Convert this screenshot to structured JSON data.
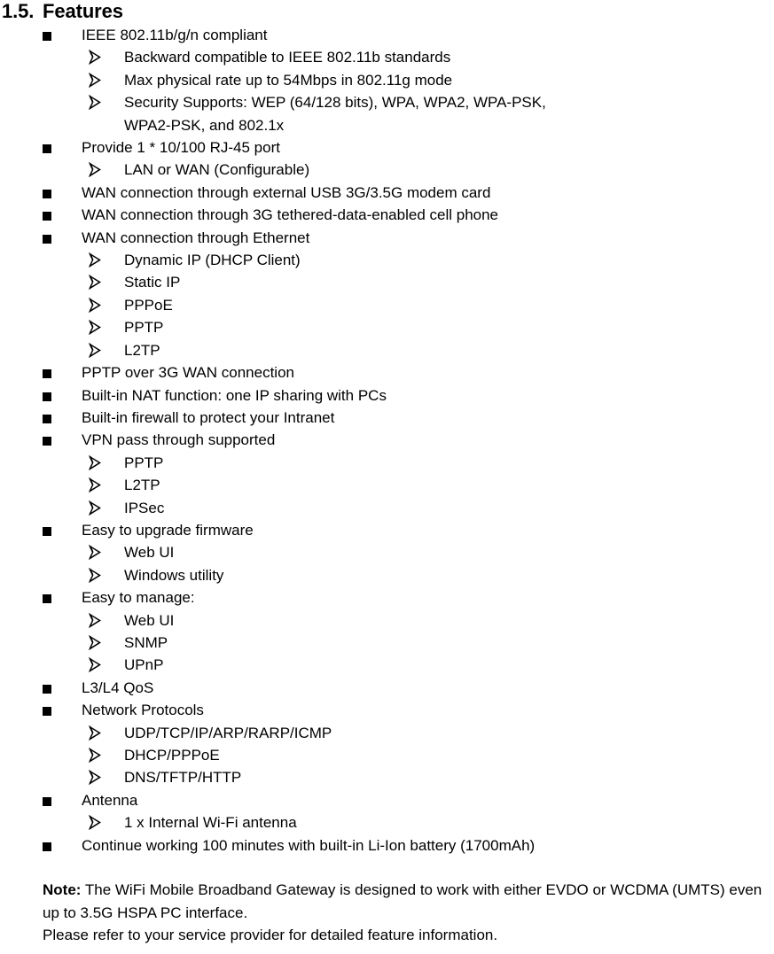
{
  "document": {
    "heading": {
      "number": "1.5.",
      "title": "Features"
    },
    "features": [
      {
        "level": 1,
        "text": "IEEE 802.11b/g/n compliant"
      },
      {
        "level": 2,
        "text": "Backward compatible to IEEE 802.11b standards"
      },
      {
        "level": 2,
        "text": "Max physical rate up to 54Mbps in 802.11g mode"
      },
      {
        "level": 2,
        "text": "Security Supports: WEP (64/128 bits), WPA, WPA2, WPA-PSK,",
        "text_continued": "WPA2-PSK, and 802.1x"
      },
      {
        "level": 1,
        "text": "Provide 1 * 10/100 RJ-45 port"
      },
      {
        "level": 2,
        "text": "LAN or WAN (Configurable)"
      },
      {
        "level": 1,
        "text": "WAN connection through external USB 3G/3.5G modem card"
      },
      {
        "level": 1,
        "text": "WAN connection through 3G tethered-data-enabled cell phone"
      },
      {
        "level": 1,
        "text": "WAN connection through Ethernet"
      },
      {
        "level": 2,
        "text": "Dynamic IP (DHCP Client)"
      },
      {
        "level": 2,
        "text": "Static IP"
      },
      {
        "level": 2,
        "text": "PPPoE"
      },
      {
        "level": 2,
        "text": "PPTP"
      },
      {
        "level": 2,
        "text": "L2TP"
      },
      {
        "level": 1,
        "text": "PPTP over 3G WAN connection"
      },
      {
        "level": 1,
        "text": "Built-in NAT function: one IP sharing with PCs"
      },
      {
        "level": 1,
        "text": "Built-in firewall to protect your Intranet"
      },
      {
        "level": 1,
        "text": "VPN pass through supported"
      },
      {
        "level": 2,
        "text": "PPTP"
      },
      {
        "level": 2,
        "text": "L2TP"
      },
      {
        "level": 2,
        "text": "IPSec"
      },
      {
        "level": 1,
        "text": "Easy to upgrade firmware"
      },
      {
        "level": 2,
        "text": "Web UI"
      },
      {
        "level": 2,
        "text": "Windows utility"
      },
      {
        "level": 1,
        "text": "Easy to manage:"
      },
      {
        "level": 2,
        "text": "Web UI"
      },
      {
        "level": 2,
        "text": "SNMP"
      },
      {
        "level": 2,
        "text": "UPnP"
      },
      {
        "level": 1,
        "text": "L3/L4 QoS"
      },
      {
        "level": 1,
        "text": "Network Protocols"
      },
      {
        "level": 2,
        "text": "UDP/TCP/IP/ARP/RARP/ICMP"
      },
      {
        "level": 2,
        "text": "DHCP/PPPoE"
      },
      {
        "level": 2,
        "text": "DNS/TFTP/HTTP"
      },
      {
        "level": 1,
        "text": "Antenna"
      },
      {
        "level": 2,
        "text": "1 x Internal Wi-Fi antenna"
      },
      {
        "level": 1,
        "text": "Continue working 100 minutes with built-in Li-Ion battery (1700mAh)"
      }
    ],
    "note": {
      "label": "Note:",
      "body": " The WiFi Mobile Broadband Gateway is designed to work with either EVDO or WCDMA (UMTS) even up to 3.5G HSPA PC interface.",
      "second_line": "Please refer to your service provider for detailed feature information."
    }
  }
}
